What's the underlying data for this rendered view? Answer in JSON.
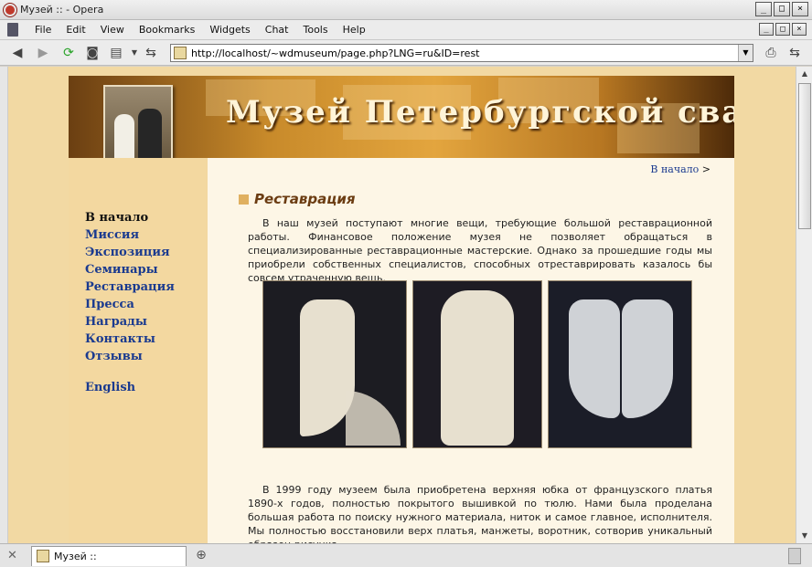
{
  "window": {
    "title": "Музей :: - Opera",
    "buttons": {
      "minimize": "_",
      "maximize": "□",
      "close": "×"
    }
  },
  "menubar": {
    "items": [
      "File",
      "Edit",
      "View",
      "Bookmarks",
      "Widgets",
      "Chat",
      "Tools",
      "Help"
    ]
  },
  "toolbar": {
    "url": "http://localhost/~wdmuseum/page.php?LNG=ru&ID=rest"
  },
  "site": {
    "banner_title": "Музей Петербургской свадьбы"
  },
  "nav": {
    "items": [
      {
        "label": "В начало",
        "current": true
      },
      {
        "label": "Миссия"
      },
      {
        "label": "Экспозиция"
      },
      {
        "label": "Семинары"
      },
      {
        "label": "Реставрация"
      },
      {
        "label": "Пресса"
      },
      {
        "label": "Награды"
      },
      {
        "label": "Контакты"
      },
      {
        "label": "Отзывы"
      }
    ],
    "english": "English"
  },
  "content": {
    "breadcrumb_link": "В начало",
    "breadcrumb_sep": ">",
    "heading": "Реставрация",
    "para1": "В наш музей поступают многие вещи, требующие большой реставрационной работы. Финансовое положение музея не позволяет обращаться в специализированные реставрационные мастерские. Однако за прошедшие годы мы приобрели собственных специалистов, способных отреставрировать казалось бы совсем утраченную вещь.",
    "para2": "В 1999 году музеем была приобретена верхняя юбка от французского платья 1890-х годов, полностью покрытого вышивкой по тюлю. Нами была проделана большая работа по поиску нужного материала, ниток и самое главное, исполнителя. Мы полностью восстановили верх платья, манжеты, воротник, сотворив уникальный образец рисунка,"
  },
  "statusbar": {
    "tab_title": "Музей ::"
  }
}
